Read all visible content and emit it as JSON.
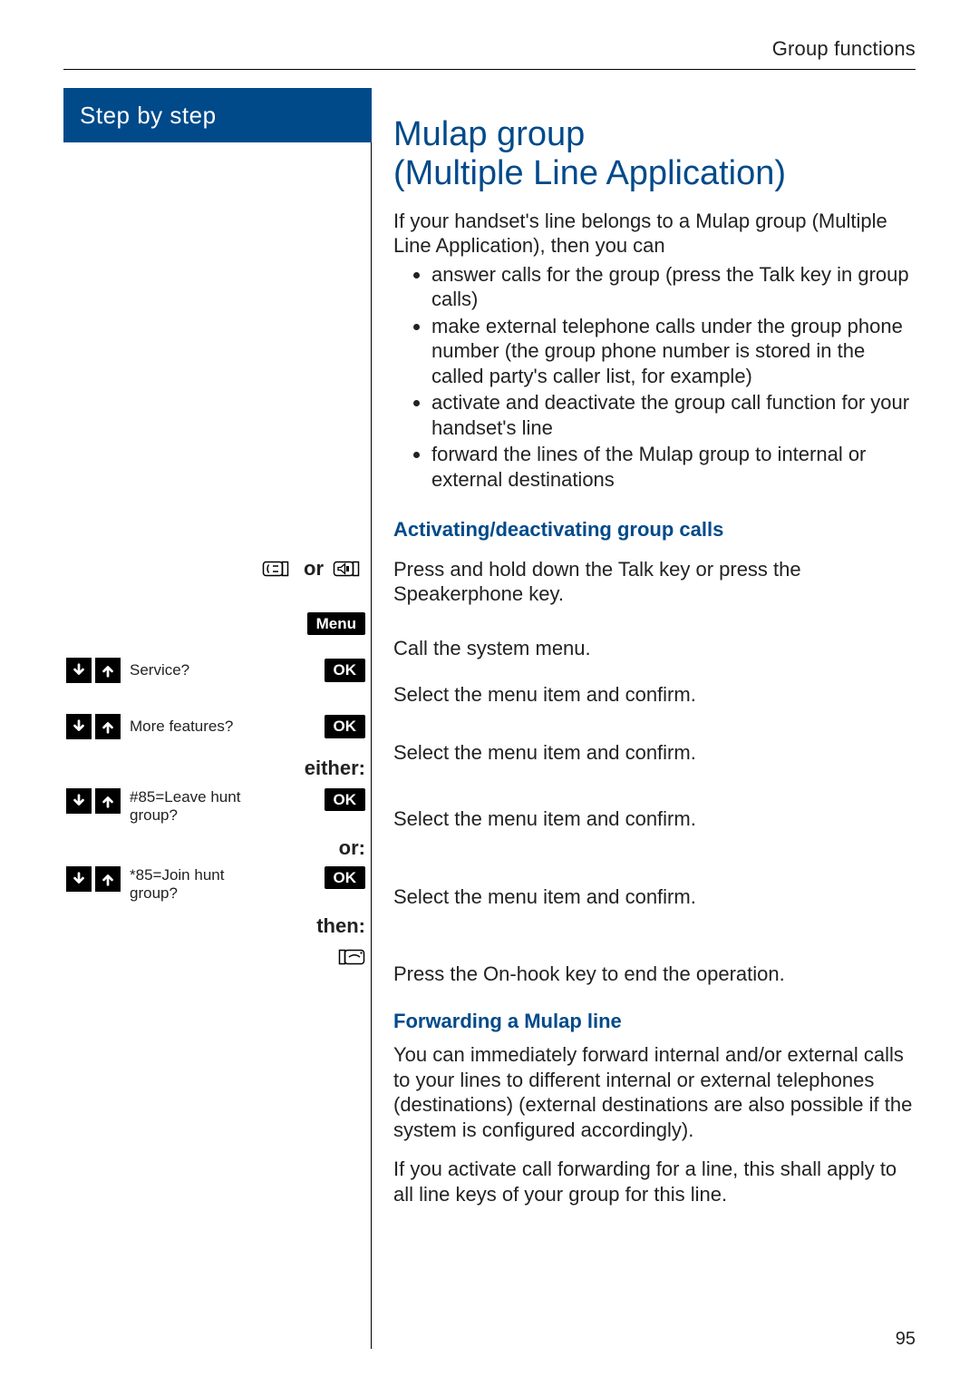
{
  "header": {
    "section": "Group functions"
  },
  "sidebar": {
    "title": "Step by step",
    "rows": {
      "talk_or": "or",
      "menu": "Menu",
      "service": "Service?",
      "more_features": "More features?",
      "either": "either:",
      "leave_hunt": "#85=Leave hunt group?",
      "or": "or:",
      "join_hunt": "*85=Join hunt group?",
      "then": "then:",
      "ok": "OK"
    }
  },
  "content": {
    "title_line1": "Mulap group",
    "title_line2": "(Multiple Line Application)",
    "intro": "If your handset's line belongs to a Mulap group (Multiple Line Application), then you can",
    "bullets": [
      "answer calls for the group (press the Talk key in group calls)",
      "make external telephone calls under the group phone number (the group phone number is stored in the called party's caller list, for example)",
      "activate and deactivate the group call function for your handset's line",
      "forward the lines of the Mulap group to internal or external destinations"
    ],
    "sub1": "Activating/deactivating group calls",
    "press_talk": "Press and hold down the Talk key or press the Speakerphone key.",
    "call_menu": "Call the system menu.",
    "select_confirm": "Select the menu item and confirm.",
    "press_onhook": "Press the On-hook key to end the operation.",
    "sub2": "Forwarding a Mulap line",
    "fwd_p1": "You can immediately forward internal and/or external calls to your lines to different internal or external telephones (destinations) (external destinations are also possible if the system is configured accordingly).",
    "fwd_p2": "If you activate call forwarding for a line, this shall apply to all line keys of your group for this line."
  },
  "page_number": "95"
}
